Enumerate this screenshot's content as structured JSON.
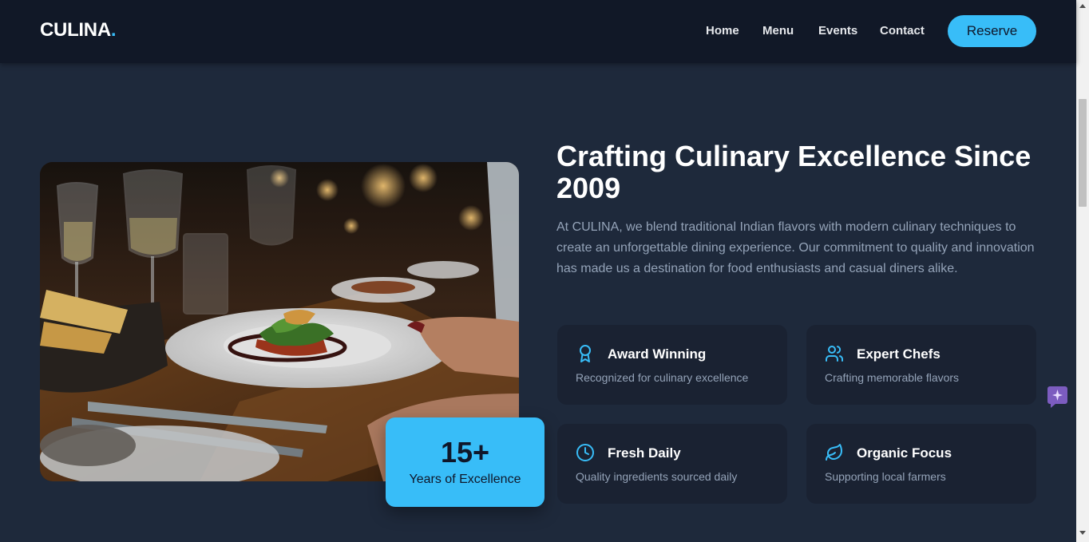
{
  "header": {
    "logo": "CULINA",
    "logo_dot": ".",
    "nav": [
      "Home",
      "Menu",
      "Events",
      "Contact"
    ],
    "reserve_label": "Reserve"
  },
  "about": {
    "title": "Crafting Culinary Excellence Since 2009",
    "description": "At CULINA, we blend traditional Indian flavors with modern culinary techniques to create an unforgettable dining experience. Our commitment to quality and innovation has made us a destination for food enthusiasts and casual diners alike.",
    "badge": {
      "number": "15+",
      "label": "Years of Excellence"
    },
    "features": [
      {
        "icon": "award-icon",
        "title": "Award Winning",
        "text": "Recognized for culinary excellence"
      },
      {
        "icon": "users-icon",
        "title": "Expert Chefs",
        "text": "Crafting memorable flavors"
      },
      {
        "icon": "clock-icon",
        "title": "Fresh Daily",
        "text": "Quality ingredients sourced daily"
      },
      {
        "icon": "leaf-icon",
        "title": "Organic Focus",
        "text": "Supporting local farmers"
      }
    ]
  },
  "colors": {
    "accent": "#38bdf8",
    "background": "#1e293b",
    "header": "#111827",
    "card": "#1a2232",
    "muted_text": "#94a3b8",
    "chat_widget": "#7c5cbf"
  },
  "icons": {
    "chat_widget": "sparkle-chat-icon"
  }
}
